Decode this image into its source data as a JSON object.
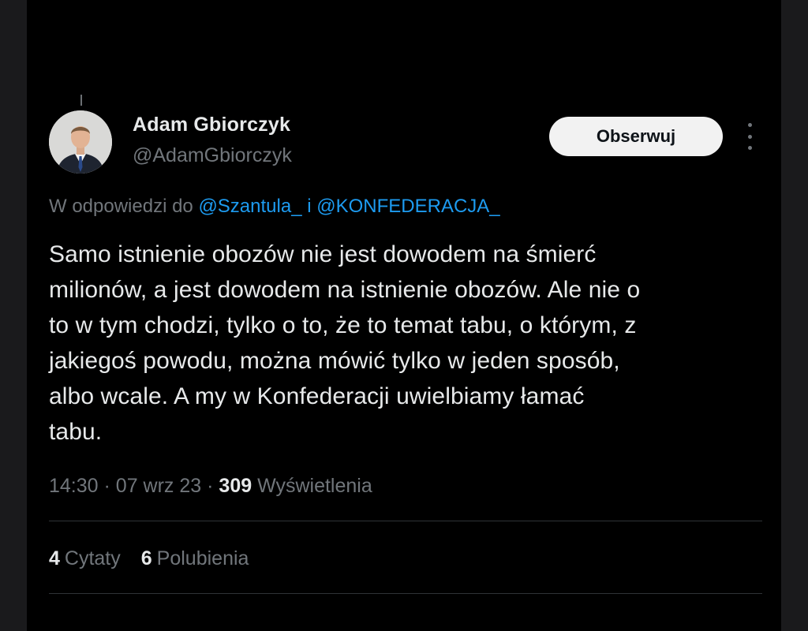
{
  "author": {
    "name": "Adam Gbiorczyk",
    "handle": "@AdamGbiorczyk"
  },
  "follow_button": {
    "label": "Obserwuj"
  },
  "reply_context": {
    "prefix": "W odpowiedzi do",
    "mention_1": "@Szantula_",
    "joiner": "i",
    "mention_2": "@KONFEDERACJA_"
  },
  "tweet": {
    "text": "Samo istnienie obozów nie jest dowodem na śmierć\nmilionów, a jest dowodem na istnienie obozów. Ale nie o\nto w tym chodzi, tylko o to, że to temat tabu, o którym, z\njakiegoś powodu, można mówić tylko w jeden sposób,\nalbo wcale. A my w Konfederacji uwielbiamy łamać\ntabu."
  },
  "meta": {
    "time": "14:30",
    "separator": "·",
    "date": "07 wrz 23",
    "views_count": "309",
    "views_label": "Wyświetlenia"
  },
  "stats": {
    "quotes_count": "4",
    "quotes_label": "Cytaty",
    "likes_count": "6",
    "likes_label": "Polubienia"
  },
  "colors": {
    "background": "#000000",
    "text": "#e7e9ea",
    "secondary": "#71767b",
    "link": "#1d9bf0",
    "button_bg": "#f2f2f2"
  },
  "icons": {
    "more": "more-vertical-icon"
  }
}
